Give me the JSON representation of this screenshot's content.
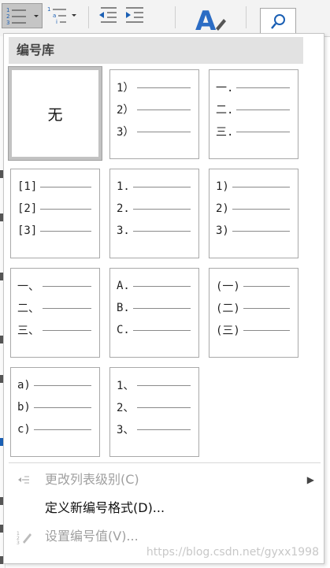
{
  "ribbon": {
    "numbering_button": "numbering-list",
    "multilevel_button": "multilevel-list",
    "decrease_indent": "decrease-indent",
    "increase_indent": "increase-indent",
    "styles_icon": "A",
    "find_icon": "search"
  },
  "panel": {
    "section_title": "编号库",
    "tiles": [
      {
        "type": "none",
        "label": "无",
        "selected": true
      },
      {
        "type": "list",
        "markers": [
          "1）",
          "2）",
          "3）"
        ]
      },
      {
        "type": "list",
        "markers": [
          "一.",
          "二.",
          "三."
        ]
      },
      {
        "type": "list",
        "markers": [
          "[1]",
          "[2]",
          "[3]"
        ]
      },
      {
        "type": "list",
        "markers": [
          "1.",
          "2.",
          "3."
        ]
      },
      {
        "type": "list",
        "markers": [
          "1)",
          "2)",
          "3)"
        ]
      },
      {
        "type": "list",
        "markers": [
          "一、",
          "二、",
          "三、"
        ]
      },
      {
        "type": "list",
        "markers": [
          "A.",
          "B.",
          "C."
        ]
      },
      {
        "type": "list",
        "markers": [
          "(一)",
          "(二)",
          "(三)"
        ]
      },
      {
        "type": "list",
        "markers": [
          "a)",
          "b)",
          "c)"
        ]
      },
      {
        "type": "list",
        "markers": [
          "1、",
          "2、",
          "3、"
        ]
      }
    ]
  },
  "menu": {
    "change_level": {
      "label": "更改列表级别(C)",
      "enabled": false,
      "icon": "change-level-icon"
    },
    "define_format": {
      "label": "定义新编号格式(D)...",
      "enabled": true
    },
    "set_value": {
      "label": "设置编号值(V)...",
      "enabled": false,
      "icon": "set-value-icon"
    }
  },
  "watermark": "https://blog.csdn.net/gyxx1998"
}
